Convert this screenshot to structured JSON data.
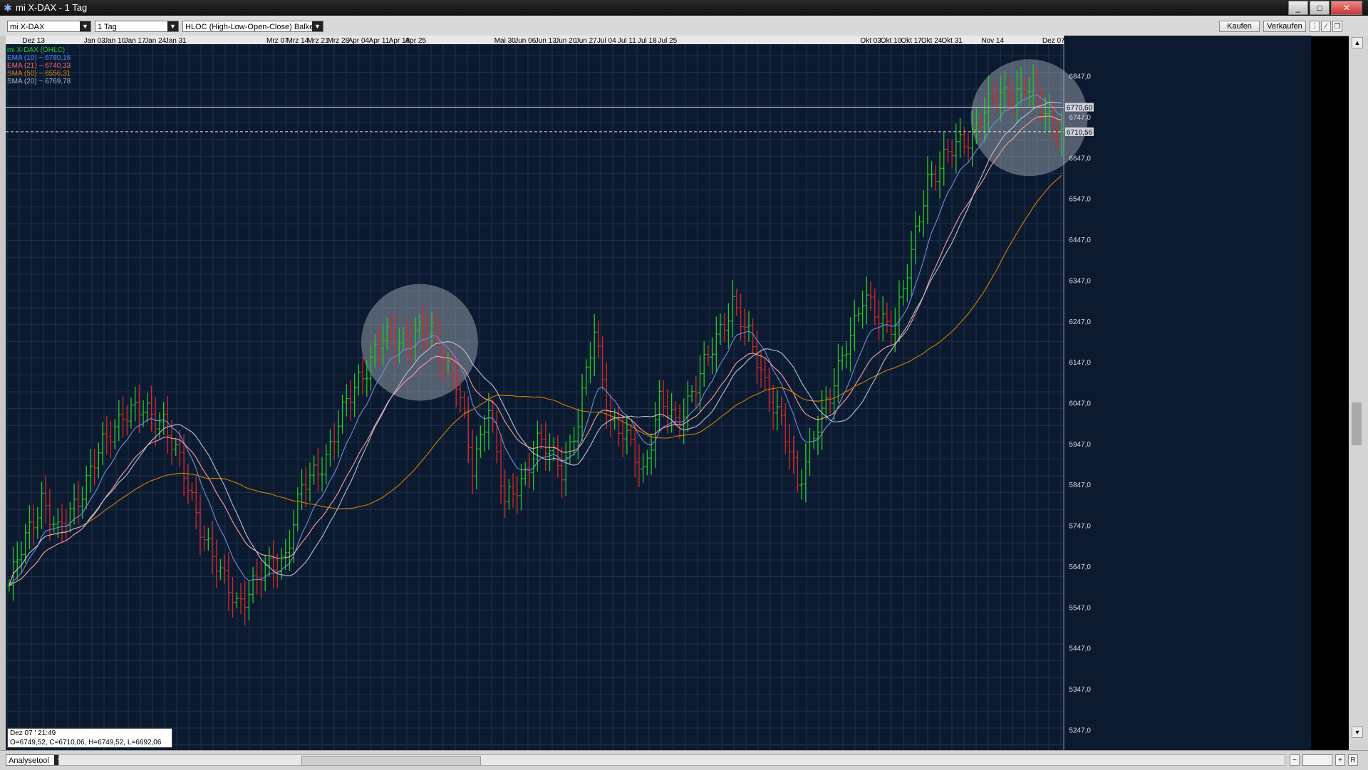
{
  "window": {
    "title": "mi X-DAX - 1 Tag",
    "controls": [
      "_",
      "□",
      "✕"
    ]
  },
  "toolbar": {
    "instrument": "mi X-DAX",
    "period": "1 Tag",
    "chart_style": "HLOC (High-Low-Open-Close) Balken",
    "buy_label": "Kaufen",
    "sell_label": "Verkaufen"
  },
  "legend": [
    {
      "label": "mi X-DAX (OHLC)",
      "color": "#22cc22"
    },
    {
      "label": "EMA (10) ~ 6780,16",
      "color": "#4a8cff"
    },
    {
      "label": "EMA (21) ~ 6740,33",
      "color": "#ff6a6a"
    },
    {
      "label": "SMA (50) ~ 6556,31",
      "color": "#e08a00"
    },
    {
      "label": "SMA (20) ~ 6769,78",
      "color": "#aab4c8"
    }
  ],
  "crosshair": {
    "datetime": "Dez 07 ' 21:49",
    "ohlc": "O=6749,52, C=6710,06, H=6749,52, L=6692,06"
  },
  "price_markers": {
    "current": "6770,60",
    "last": "6710,56"
  },
  "bottombar": {
    "tool_label": "Analysetool"
  },
  "chart_data": {
    "type": "ohlc",
    "title": "mi X-DAX (OHLC)",
    "xlabel": "",
    "ylabel": "",
    "ylim": [
      5197,
      6897
    ],
    "yticks": [
      "6847,0",
      "6747,0",
      "6647,0",
      "6547,0",
      "6447,0",
      "6347,0",
      "6247,0",
      "6147,0",
      "6047,0",
      "5947,0",
      "5847,0",
      "5747,0",
      "5647,0",
      "5547,0",
      "5447,0",
      "5347,0",
      "5247,0"
    ],
    "xtick_labels": [
      {
        "label": "Dez 13",
        "idx": 6
      },
      {
        "label": "Jan 03",
        "idx": 21
      },
      {
        "label": "Jan 10",
        "idx": 26
      },
      {
        "label": "Jan 17",
        "idx": 31
      },
      {
        "label": "Jan 24",
        "idx": 36
      },
      {
        "label": "Jan 31",
        "idx": 41
      },
      {
        "label": "Mrz 07",
        "idx": 66
      },
      {
        "label": "Mrz 14",
        "idx": 71
      },
      {
        "label": "Mrz 21",
        "idx": 76
      },
      {
        "label": "Mrz 28",
        "idx": 81
      },
      {
        "label": "Apr 04",
        "idx": 86
      },
      {
        "label": "Apr 11",
        "idx": 91
      },
      {
        "label": "Apr 18",
        "idx": 96
      },
      {
        "label": "Apr 25",
        "idx": 100
      },
      {
        "label": "Mai 30",
        "idx": 122
      },
      {
        "label": "Jun 06",
        "idx": 127
      },
      {
        "label": "Jun 13",
        "idx": 132
      },
      {
        "label": "Jun 20",
        "idx": 137
      },
      {
        "label": "Jun 27",
        "idx": 142
      },
      {
        "label": "Jul 04",
        "idx": 147
      },
      {
        "label": "Jul 11",
        "idx": 152
      },
      {
        "label": "Jul 18",
        "idx": 157
      },
      {
        "label": "Jul 25",
        "idx": 162
      },
      {
        "label": "Okt 03",
        "idx": 212
      },
      {
        "label": "Okt 10",
        "idx": 217
      },
      {
        "label": "Okt 17",
        "idx": 222
      },
      {
        "label": "Okt 24",
        "idx": 227
      },
      {
        "label": "Okt 31",
        "idx": 232
      },
      {
        "label": "Nov 14",
        "idx": 242
      },
      {
        "label": "Dez 07",
        "idx": 257
      }
    ],
    "bars": 260,
    "close_keypoints": [
      [
        0,
        5600
      ],
      [
        8,
        5820
      ],
      [
        12,
        5720
      ],
      [
        20,
        5880
      ],
      [
        28,
        6030
      ],
      [
        38,
        6010
      ],
      [
        46,
        5780
      ],
      [
        52,
        5620
      ],
      [
        56,
        5560
      ],
      [
        62,
        5620
      ],
      [
        68,
        5680
      ],
      [
        72,
        5830
      ],
      [
        78,
        5920
      ],
      [
        86,
        6110
      ],
      [
        92,
        6200
      ],
      [
        98,
        6210
      ],
      [
        104,
        6220
      ],
      [
        110,
        6100
      ],
      [
        114,
        5880
      ],
      [
        118,
        6050
      ],
      [
        122,
        5790
      ],
      [
        126,
        5860
      ],
      [
        130,
        5950
      ],
      [
        136,
        5890
      ],
      [
        140,
        6000
      ],
      [
        144,
        6220
      ],
      [
        148,
        6010
      ],
      [
        152,
        5950
      ],
      [
        156,
        5880
      ],
      [
        160,
        6050
      ],
      [
        164,
        5990
      ],
      [
        168,
        6080
      ],
      [
        172,
        6150
      ],
      [
        178,
        6300
      ],
      [
        182,
        6200
      ],
      [
        186,
        6100
      ],
      [
        190,
        6000
      ],
      [
        194,
        5840
      ],
      [
        198,
        5980
      ],
      [
        202,
        6050
      ],
      [
        206,
        6200
      ],
      [
        210,
        6300
      ],
      [
        214,
        6250
      ],
      [
        218,
        6250
      ],
      [
        222,
        6400
      ],
      [
        226,
        6600
      ],
      [
        230,
        6640
      ],
      [
        236,
        6700
      ],
      [
        240,
        6760
      ],
      [
        244,
        6800
      ],
      [
        250,
        6820
      ],
      [
        256,
        6750
      ],
      [
        259,
        6710
      ]
    ],
    "series": [
      {
        "name": "EMA (10)",
        "period": 10,
        "kind": "ema",
        "color": "#6f8fd8"
      },
      {
        "name": "EMA (21)",
        "period": 21,
        "kind": "ema",
        "color": "#ff9e9e"
      },
      {
        "name": "SMA (50)",
        "period": 50,
        "kind": "sma",
        "color": "#d08000"
      },
      {
        "name": "SMA (20)",
        "period": 20,
        "kind": "sma",
        "color": "#b8c2d6"
      }
    ],
    "grid": true,
    "highlight_circles": [
      {
        "center_idx": 101,
        "center_price": 6195
      },
      {
        "center_idx": 251,
        "center_price": 6745
      }
    ]
  }
}
